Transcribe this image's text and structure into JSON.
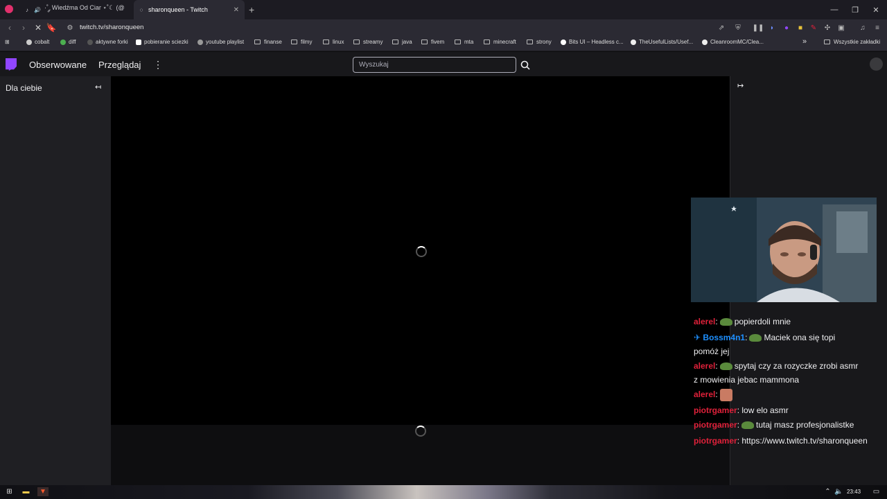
{
  "browser": {
    "tabs": [
      {
        "label": "·˚ ༘ Wiedźma Od Ciar ⋆˚☾ (@",
        "active": false
      },
      {
        "label": "sharonqueen - Twitch",
        "active": true
      }
    ],
    "new_tab": "+",
    "url": "twitch.tv/sharonqueen",
    "bookmarks": [
      {
        "label": "cobalt",
        "icon": "cobalt-icon"
      },
      {
        "label": "diff",
        "icon": "diff-icon"
      },
      {
        "label": "aktywne forki",
        "icon": "fork-icon"
      },
      {
        "label": "pobieranie sciezki",
        "icon": "download-icon"
      },
      {
        "label": "youtube playlist",
        "icon": "globe-icon"
      },
      {
        "label": "finanse",
        "icon": "folder-icon"
      },
      {
        "label": "filmy",
        "icon": "folder-icon"
      },
      {
        "label": "linux",
        "icon": "folder-icon"
      },
      {
        "label": "streamy",
        "icon": "folder-icon"
      },
      {
        "label": "java",
        "icon": "folder-icon"
      },
      {
        "label": "fivem",
        "icon": "folder-icon"
      },
      {
        "label": "mta",
        "icon": "folder-icon"
      },
      {
        "label": "minecraft",
        "icon": "folder-icon"
      },
      {
        "label": "strony",
        "icon": "folder-icon"
      },
      {
        "label": "Bits UI – Headless c...",
        "icon": "bits-icon"
      },
      {
        "label": "TheUsefulLists/Usef...",
        "icon": "github-icon"
      },
      {
        "label": "CleanroomMC/Clea...",
        "icon": "github-icon"
      }
    ],
    "more_bookmarks": "»",
    "all_bookmarks": "Wszystkie zakładki"
  },
  "twitch": {
    "nav": {
      "following": "Obserwowane",
      "browse": "Przeglądaj",
      "more": "⋮"
    },
    "search_placeholder": "Wyszukaj",
    "sidebar_title": "Dla ciebie",
    "collapse_icon": "↤",
    "expand_icon": "↦"
  },
  "chat": {
    "messages": [
      {
        "user": "alerel",
        "color": "#e0213a",
        "emote": "pepe",
        "text": "popierdoli mnie"
      },
      {
        "user": "Bossm4n1",
        "color": "#1e90ff",
        "badge": "✈",
        "emote": "pepe",
        "text": "Maciek ona się topi",
        "text2": "pomóż jej"
      },
      {
        "user": "alerel",
        "color": "#e0213a",
        "emote": "pepe",
        "text": "spytaj czy za rozyczke zrobi asmr",
        "text2": "z mowienia jebac mammona"
      },
      {
        "user": "alerel",
        "color": "#e0213a",
        "emote": "face",
        "text": ""
      },
      {
        "user": "piotrgamer",
        "color": "#e0213a",
        "emote": "",
        "text": "low elo asmr"
      },
      {
        "user": "piotrgamer",
        "color": "#e0213a",
        "emote": "pepe",
        "text": "tutaj masz profesjonalistke"
      },
      {
        "user": "piotrgamer",
        "color": "#e0213a",
        "emote": "",
        "text": "https://www.twitch.tv/sharonqueen"
      }
    ]
  },
  "taskbar": {
    "clock": "23:43"
  }
}
